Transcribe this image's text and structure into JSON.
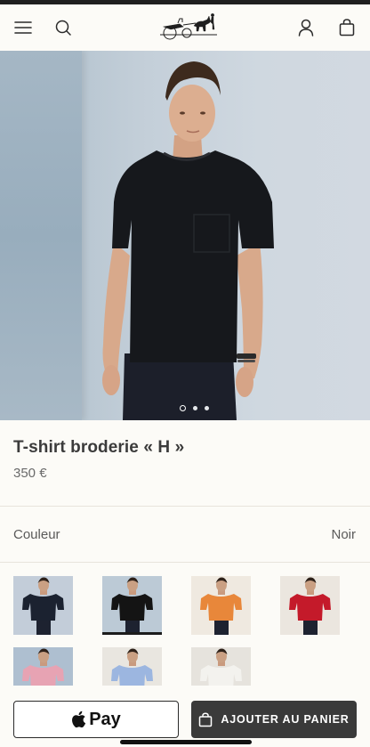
{
  "header": {
    "menu_icon": "hamburger-menu-icon",
    "search_icon": "search-icon",
    "logo": "hermes-carriage-logo",
    "account_icon": "user-account-icon",
    "bag_icon": "shopping-bag-icon"
  },
  "gallery": {
    "slide_count": 3,
    "active_slide": 1
  },
  "product": {
    "title": "T-shirt broderie « H »",
    "price": "350 €"
  },
  "color_selector": {
    "label": "Couleur",
    "selected": "Noir",
    "swatches": [
      {
        "name": "Noir porté",
        "shirt": "#1b2230",
        "bg": "#c3cdd9",
        "selected": false
      },
      {
        "name": "Noir",
        "shirt": "#141414",
        "bg": "#bccad6",
        "selected": true
      },
      {
        "name": "Orange",
        "shirt": "#e8873a",
        "bg": "#efe9e0",
        "selected": false
      },
      {
        "name": "Rouge",
        "shirt": "#c41a2a",
        "bg": "#ebe6df",
        "selected": false
      },
      {
        "name": "Rose",
        "shirt": "#e7a3b3",
        "bg": "#aebfd0",
        "selected": false
      },
      {
        "name": "Bleu ciel",
        "shirt": "#9cb6e0",
        "bg": "#e9e6e0",
        "selected": false
      },
      {
        "name": "Blanc",
        "shirt": "#f3f2ee",
        "bg": "#e6e3dd",
        "selected": false
      }
    ]
  },
  "actions": {
    "apple_pay_label": "Pay",
    "add_to_cart_label": "AJOUTER AU PANIER"
  },
  "colors": {
    "background": "#fcfbf7",
    "button_dark": "#3a3a3a",
    "text": "#3b3b3b"
  }
}
